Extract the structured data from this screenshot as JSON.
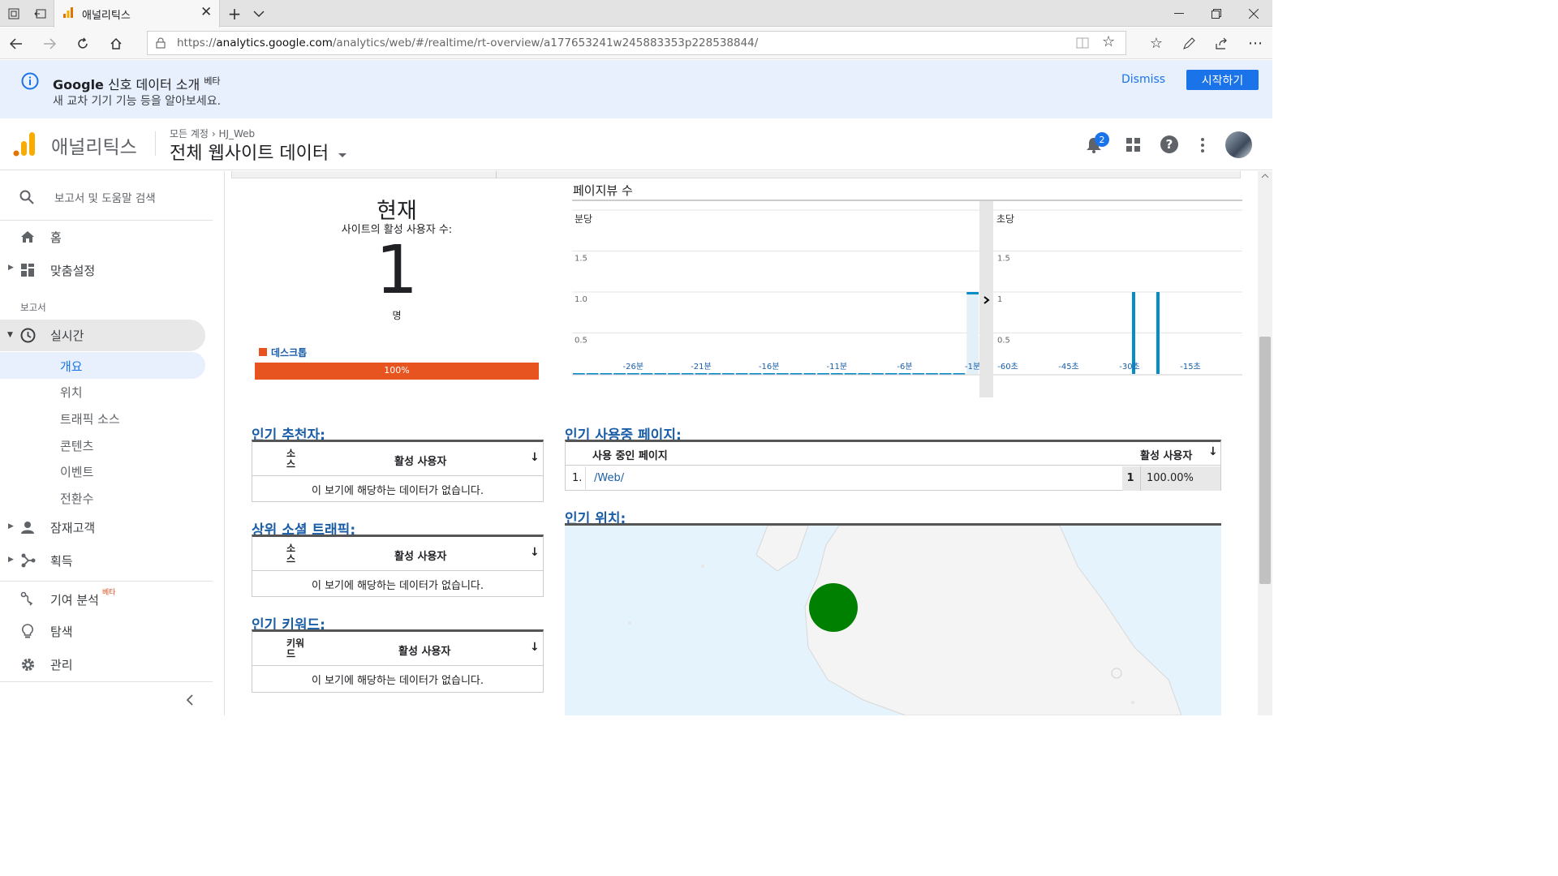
{
  "browser": {
    "tab_title": "애널리틱스",
    "url_prefix": "https://",
    "url_host": "analytics.google.com",
    "url_path": "/analytics/web/#/realtime/rt-overview/a177653241w245883353p228538844/"
  },
  "banner": {
    "brand": "Google",
    "title": " 신호 데이터 소개",
    "badge": "베타",
    "subtitle": "새 교차 기기 기능 등을 알아보세요.",
    "dismiss": "Dismiss",
    "start": "시작하기"
  },
  "header": {
    "product": "애널리틱스",
    "breadcrumb_account": "모든 계정",
    "breadcrumb_property": "HJ_Web",
    "view": "전체 웹사이트 데이터",
    "notification_count": "2"
  },
  "sidebar": {
    "search": "보고서 및 도움말 검색",
    "home": "홈",
    "custom": "맞춤설정",
    "reports_label": "보고서",
    "realtime": "실시간",
    "sub_items": [
      "개요",
      "위치",
      "트래픽 소스",
      "콘텐츠",
      "이벤트",
      "전환수"
    ],
    "audience": "잠재고객",
    "acquisition": "획득",
    "attribution": "기여 분석",
    "attribution_badge": "베타",
    "discover": "탐색",
    "admin": "관리"
  },
  "summary": {
    "now": "현재",
    "active_label": "사이트의 활성 사용자 수:",
    "count": "1",
    "unit": "명",
    "device_label": "데스크톱",
    "device_pct": "100%",
    "device_fraction": 1.0,
    "device_color": "#e8541f"
  },
  "pageviews": {
    "title": "페이지뷰 수",
    "per_minute": "분당",
    "per_second": "초당"
  },
  "chart_data": [
    {
      "type": "bar",
      "title": "분당",
      "y_ticks": [
        "1.5",
        "1.0",
        "0.5"
      ],
      "ylim": [
        0,
        2
      ],
      "x_ticks": [
        "-26분",
        "-21분",
        "-16분",
        "-11분",
        "-6분",
        "-1분"
      ],
      "values": [
        0,
        0,
        0,
        0,
        0,
        0,
        0,
        0,
        0,
        0,
        0,
        0,
        0,
        0,
        0,
        0,
        0,
        0,
        0,
        0,
        0,
        0,
        0,
        0,
        0,
        0,
        0,
        0,
        0,
        1
      ],
      "color": "#058dc7"
    },
    {
      "type": "bar",
      "title": "초당",
      "y_ticks": [
        "1.5",
        "1",
        "0.5"
      ],
      "ylim": [
        0,
        2
      ],
      "x_ticks": [
        "-60초",
        "-45초",
        "-30초",
        "-15초"
      ],
      "x_values": [
        -60,
        -45,
        -30,
        -15
      ],
      "bars": [
        {
          "x": -29,
          "value": 1
        },
        {
          "x": -23,
          "value": 1
        }
      ],
      "color": "#058dc7"
    }
  ],
  "referrers": {
    "title": "인기 추천자:",
    "col1": "소스",
    "col2": "활성 사용자",
    "empty": "이 보기에 해당하는 데이터가 없습니다."
  },
  "social": {
    "title": "상위 소셜 트래픽:",
    "col1": "소스",
    "col2": "활성 사용자",
    "empty": "이 보기에 해당하는 데이터가 없습니다."
  },
  "keywords": {
    "title": "인기 키워드:",
    "col1": "키워드",
    "col2": "활성 사용자",
    "empty": "이 보기에 해당하는 데이터가 없습니다."
  },
  "pages": {
    "title": "인기 사용중 페이지:",
    "col1": "사용 중인 페이지",
    "col2": "활성 사용자",
    "rows": [
      {
        "rank": "1.",
        "page": "/Web/",
        "users": "1",
        "pct": "100.00%"
      }
    ]
  },
  "locations": {
    "title": "인기 위치:",
    "marker_color": "#008000"
  }
}
